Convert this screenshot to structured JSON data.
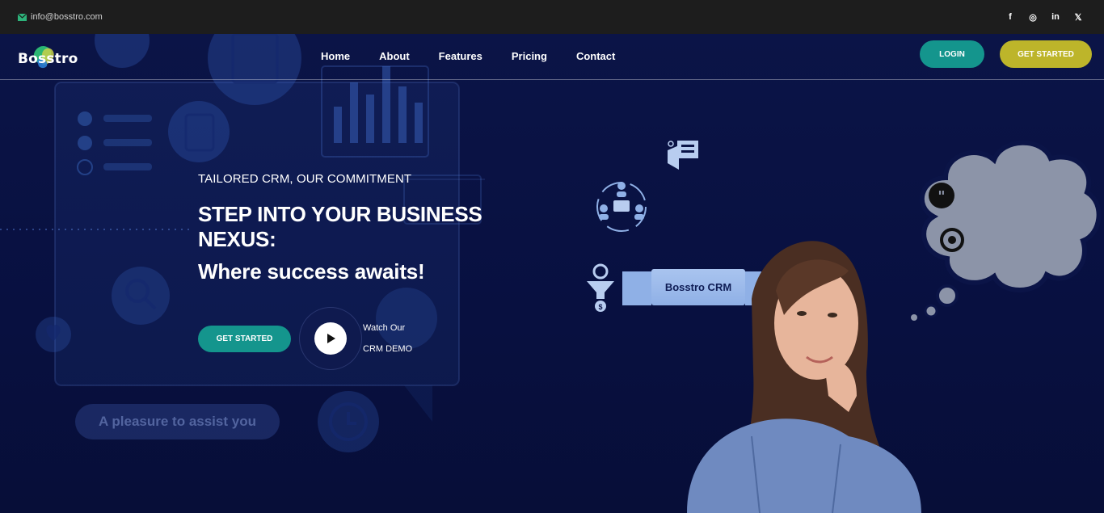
{
  "topbar": {
    "email": "info@bosstro.com",
    "socials": [
      "f",
      "◎",
      "in",
      "𝕏"
    ]
  },
  "brand": {
    "name": "Bosstro"
  },
  "nav": {
    "items": [
      "Home",
      "About",
      "Features",
      "Pricing",
      "Contact"
    ],
    "login": "LOGIN",
    "get_started": "GET STARTED"
  },
  "hero": {
    "eyebrow": "TAILORED CRM, OUR COMMITMENT",
    "headline": "STEP INTO YOUR BUSINESS NEXUS:",
    "subline": "Where success awaits!",
    "cta": "GET STARTED",
    "demo_line1": "Watch Our",
    "demo_line2": "CRM DEMO"
  },
  "illustration": {
    "crm_label": "Bosstro CRM",
    "assist_text": "A pleasure to assist you"
  },
  "colors": {
    "teal": "#14958d",
    "olive": "#bdb52a",
    "navy": "#0a1242",
    "topbar": "#1d1d1d"
  }
}
